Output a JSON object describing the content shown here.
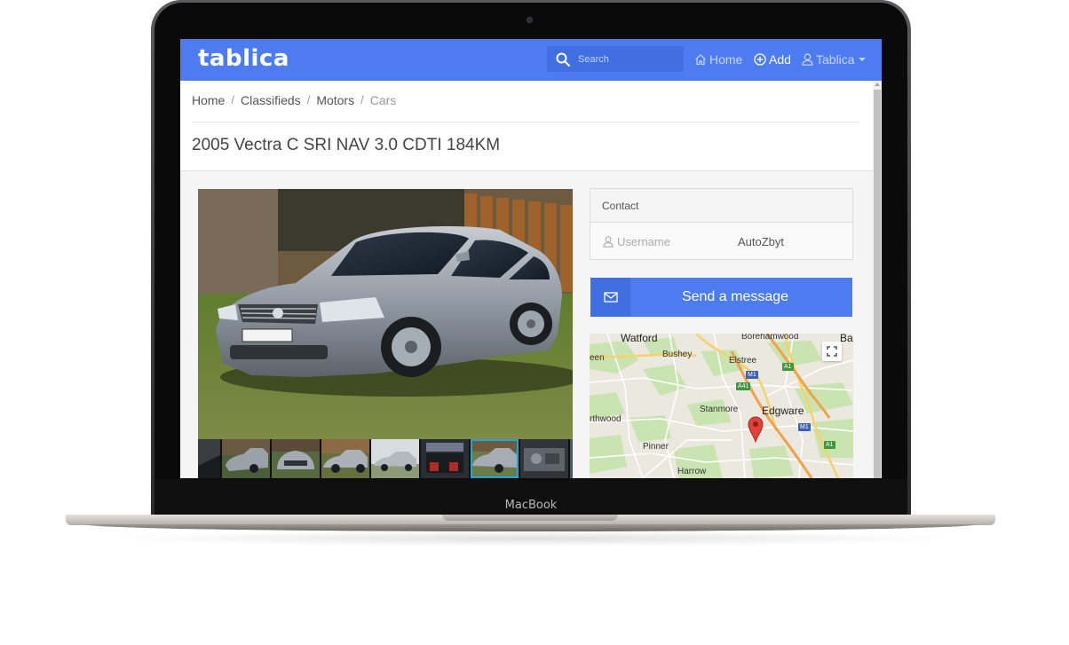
{
  "device": {
    "brand_label": "MacBook"
  },
  "navbar": {
    "logo": "tablica",
    "search_placeholder": "Search",
    "home_label": "Home",
    "add_label": "Add",
    "user_label": "Tablica",
    "accent_color": "#4c7cf0"
  },
  "breadcrumb": {
    "items": [
      "Home",
      "Classifieds",
      "Motors",
      "Cars"
    ],
    "separator": "/"
  },
  "listing": {
    "title": "2005 Vectra C SRI NAV 3.0 CDTI 184KM",
    "photo_description_icon": "car-photo",
    "thumbnail_count": 8,
    "selected_thumbnail": 6
  },
  "contact": {
    "heading": "Contact",
    "username_label": "Username",
    "username_value": "AutoZbyt",
    "send_button": "Send a message"
  },
  "map": {
    "places": [
      "Watford",
      "Borehamwood",
      "Ba",
      "Bushey",
      "Elstree",
      "een",
      "Stanmore",
      "Edgware",
      "rthwood",
      "Pinner",
      "Harrow"
    ],
    "road_shields": [
      "A1",
      "M1",
      "A41",
      "M1",
      "A1"
    ]
  }
}
